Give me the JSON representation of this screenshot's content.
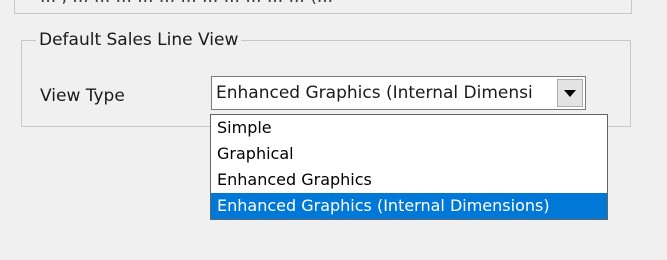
{
  "top_partial": {
    "text": "... , ... ... ... ... ... ... ... ... ... ... ... (..."
  },
  "group": {
    "title": "Default Sales Line View",
    "label": "View Type"
  },
  "combo": {
    "value": "Enhanced Graphics (Internal Dimensi"
  },
  "dropdown": {
    "items": [
      "Simple",
      "Graphical",
      "Enhanced Graphics",
      "Enhanced Graphics (Internal Dimensions)"
    ],
    "selected_index": 3
  },
  "colors": {
    "selected": "#0078d7",
    "background": "#f0f0f0"
  }
}
